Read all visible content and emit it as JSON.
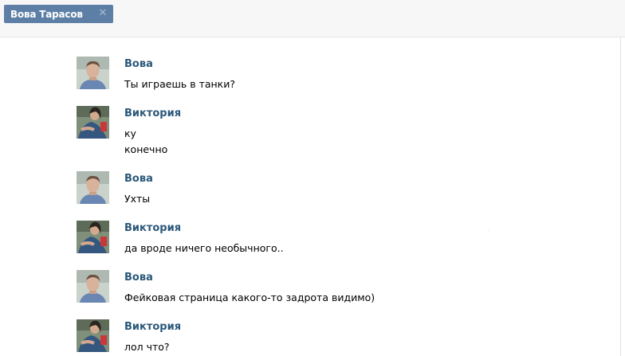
{
  "tab": {
    "label": "Вова Тарасов",
    "close_icon": "close-icon"
  },
  "messages": [
    {
      "author": "Вова",
      "avatar": "vova-photo",
      "lines": [
        "Ты играешь в танки?"
      ]
    },
    {
      "author": "Виктория",
      "avatar": "viktoria-photo",
      "lines": [
        "ку",
        "конечно"
      ]
    },
    {
      "author": "Вова",
      "avatar": "vova-photo",
      "lines": [
        "Ухты"
      ]
    },
    {
      "author": "Виктория",
      "avatar": "viktoria-photo",
      "lines": [
        "да вроде ничего необычного.."
      ]
    },
    {
      "author": "Вова",
      "avatar": "vova-photo",
      "lines": [
        "Фейковая страница какого-то задрота видимо)"
      ]
    },
    {
      "author": "Виктория",
      "avatar": "viktoria-photo",
      "lines": [
        "лол что?"
      ]
    }
  ],
  "colors": {
    "tab_bg": "#5d7fa6",
    "author": "#2b587a",
    "topbar_bg": "#f7f7f7"
  }
}
